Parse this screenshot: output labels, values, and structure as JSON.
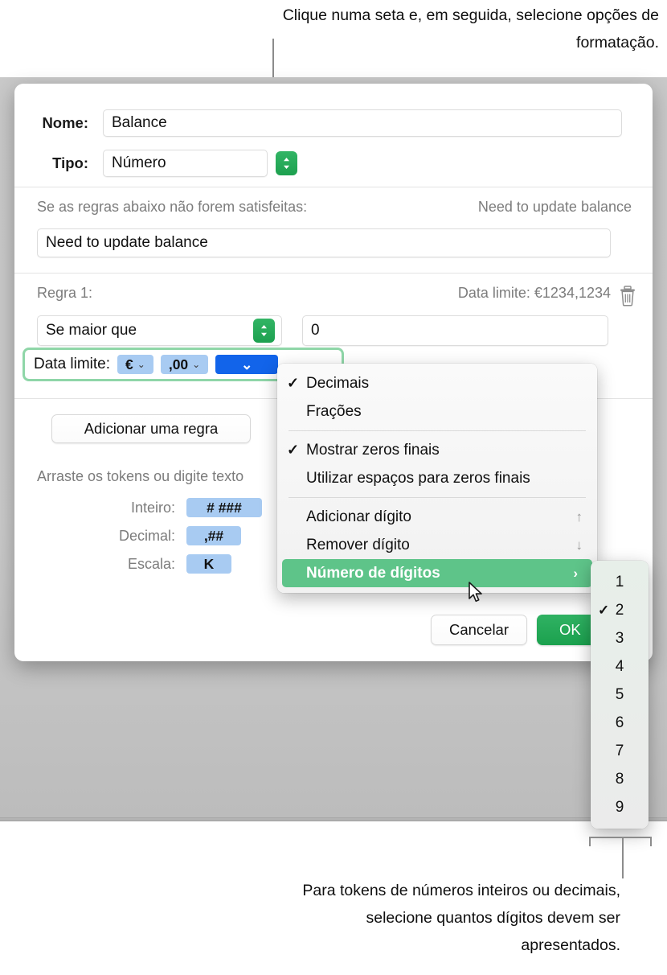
{
  "callouts": {
    "top": "Clique numa seta e, em seguida, selecione opções de formatação.",
    "bottom": "Para tokens de números inteiros ou decimais, selecione quantos dígitos devem ser apresentados."
  },
  "dialog": {
    "name_label": "Nome:",
    "name_value": "Balance",
    "type_label": "Tipo:",
    "type_value": "Número",
    "fallback_label": "Se as regras abaixo não forem satisfeitas:",
    "fallback_preview": "Need to update balance",
    "fallback_value": "Need to update balance",
    "rule_label": "Regra 1:",
    "rule_preview": "Data limite: €1234,1234",
    "condition_value": "Se maior que",
    "condition_number": "0",
    "format_prefix": "Data limite:",
    "token_currency": "€",
    "token_decimal": ",00",
    "add_rule_label": "Adicionar uma regra",
    "drag_hint": "Arraste os tokens ou digite texto",
    "tokens": [
      {
        "label": "Inteiro:",
        "value": "# ###"
      },
      {
        "label": "Decimal:",
        "value": ",##"
      },
      {
        "label": "Escala:",
        "value": "K"
      }
    ],
    "cancel_label": "Cancelar",
    "ok_label": "OK"
  },
  "menu": {
    "items": [
      {
        "label": "Decimais",
        "checked": true,
        "glyph": ""
      },
      {
        "label": "Frações",
        "checked": false,
        "glyph": ""
      },
      {
        "sep": true
      },
      {
        "label": "Mostrar zeros finais",
        "checked": true,
        "glyph": ""
      },
      {
        "label": "Utilizar espaços para zeros finais",
        "checked": false,
        "glyph": ""
      },
      {
        "sep": true
      },
      {
        "label": "Adicionar dígito",
        "checked": false,
        "glyph": "↑"
      },
      {
        "label": "Remover dígito",
        "checked": false,
        "glyph": "↓"
      },
      {
        "label": "Número de dígitos",
        "checked": false,
        "selected": true,
        "arrow": "›"
      }
    ]
  },
  "submenu": {
    "items": [
      {
        "label": "1",
        "checked": false
      },
      {
        "label": "2",
        "checked": true
      },
      {
        "label": "3",
        "checked": false
      },
      {
        "label": "4",
        "checked": false
      },
      {
        "label": "5",
        "checked": false
      },
      {
        "label": "6",
        "checked": false
      },
      {
        "label": "7",
        "checked": false
      },
      {
        "label": "8",
        "checked": false
      },
      {
        "label": "9",
        "checked": false
      }
    ]
  },
  "colors": {
    "accent_green": "#1ba14e",
    "menu_highlight": "#5ec489",
    "token_blue": "#a8cbf2",
    "token_selected_blue": "#1264ea",
    "highlight_border": "#8fd6a8"
  }
}
